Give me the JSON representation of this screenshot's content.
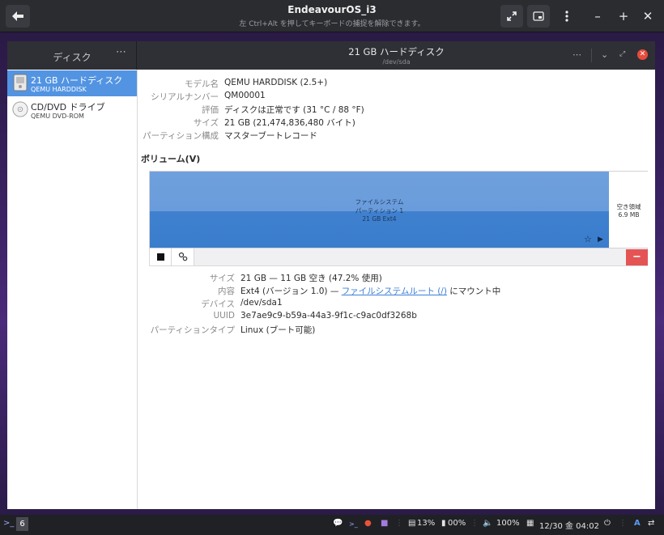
{
  "vm": {
    "title": "EndeavourOS_i3",
    "subtitle": "左 Ctrl+Alt を押してキーボードの捕捉を解除できます。",
    "back_icon": "back-arrow-icon",
    "expand_icon": "expand-icon",
    "screenshot_icon": "screenshot-icon",
    "menu_icon": "kebab-menu-icon",
    "min_label": "–",
    "max_label": "+",
    "close_label": "✕"
  },
  "app": {
    "sidebar_title": "ディスク",
    "sidebar_menu": "⋯",
    "title": "21 GB ハードディスク",
    "subtitle": "/dev/sda",
    "header_more": "⋯",
    "header_min": "⌄",
    "header_max": "⤢",
    "header_close": "✕"
  },
  "drives": [
    {
      "name": "21 GB ハードディスク",
      "model": "QEMU HARDDISK",
      "icon": "hard-disk-icon"
    },
    {
      "name": "CD/DVD ドライブ",
      "model": "QEMU DVD-ROM",
      "icon": "optical-disc-icon"
    }
  ],
  "disk_info": [
    {
      "label": "モデル名",
      "value": "QEMU HARDDISK (2.5+)"
    },
    {
      "label": "シリアルナンバー",
      "value": "QM00001"
    },
    {
      "label": "評価",
      "value": "ディスクは正常です (31 °C / 88 °F)"
    },
    {
      "label": "サイズ",
      "value": "21 GB (21,474,836,480 バイト)"
    },
    {
      "label": "パーティション構成",
      "value": "マスターブートレコード"
    }
  ],
  "volumes": {
    "heading": "ボリューム(V)",
    "partition": {
      "line1": "ファイルシステム",
      "line2": "パーティション 1",
      "line3": "21 GB Ext4"
    },
    "free": {
      "line1": "空き領域",
      "line2": "6.9 MB"
    },
    "toolbar": {
      "stop_icon": "stop-icon",
      "gears_icon": "gears-icon",
      "delete_label": "−"
    }
  },
  "partition_info": {
    "size_label": "サイズ",
    "size_value": "21 GB — 11 GB 空き (47.2% 使用)",
    "contents_label": "内容",
    "contents_prefix": "Ext4 (バージョン 1.0) — ",
    "contents_link": "ファイルシステムルート (/)",
    "contents_suffix": " にマウント中",
    "device_label": "デバイス",
    "device_value": "/dev/sda1",
    "uuid_label": "UUID",
    "uuid_value": "3e7ae9c9-b59a-44a3-9f1c-c9ac0df3268b",
    "type_label": "パーティションタイプ",
    "type_value": "Linux (ブート可能)"
  },
  "taskbar": {
    "terminal": ">_",
    "workspace": "6",
    "cpu": "13%",
    "battery": "00%",
    "volume": "100%",
    "datetime": "12/30 金 04:02",
    "ime": "A"
  }
}
